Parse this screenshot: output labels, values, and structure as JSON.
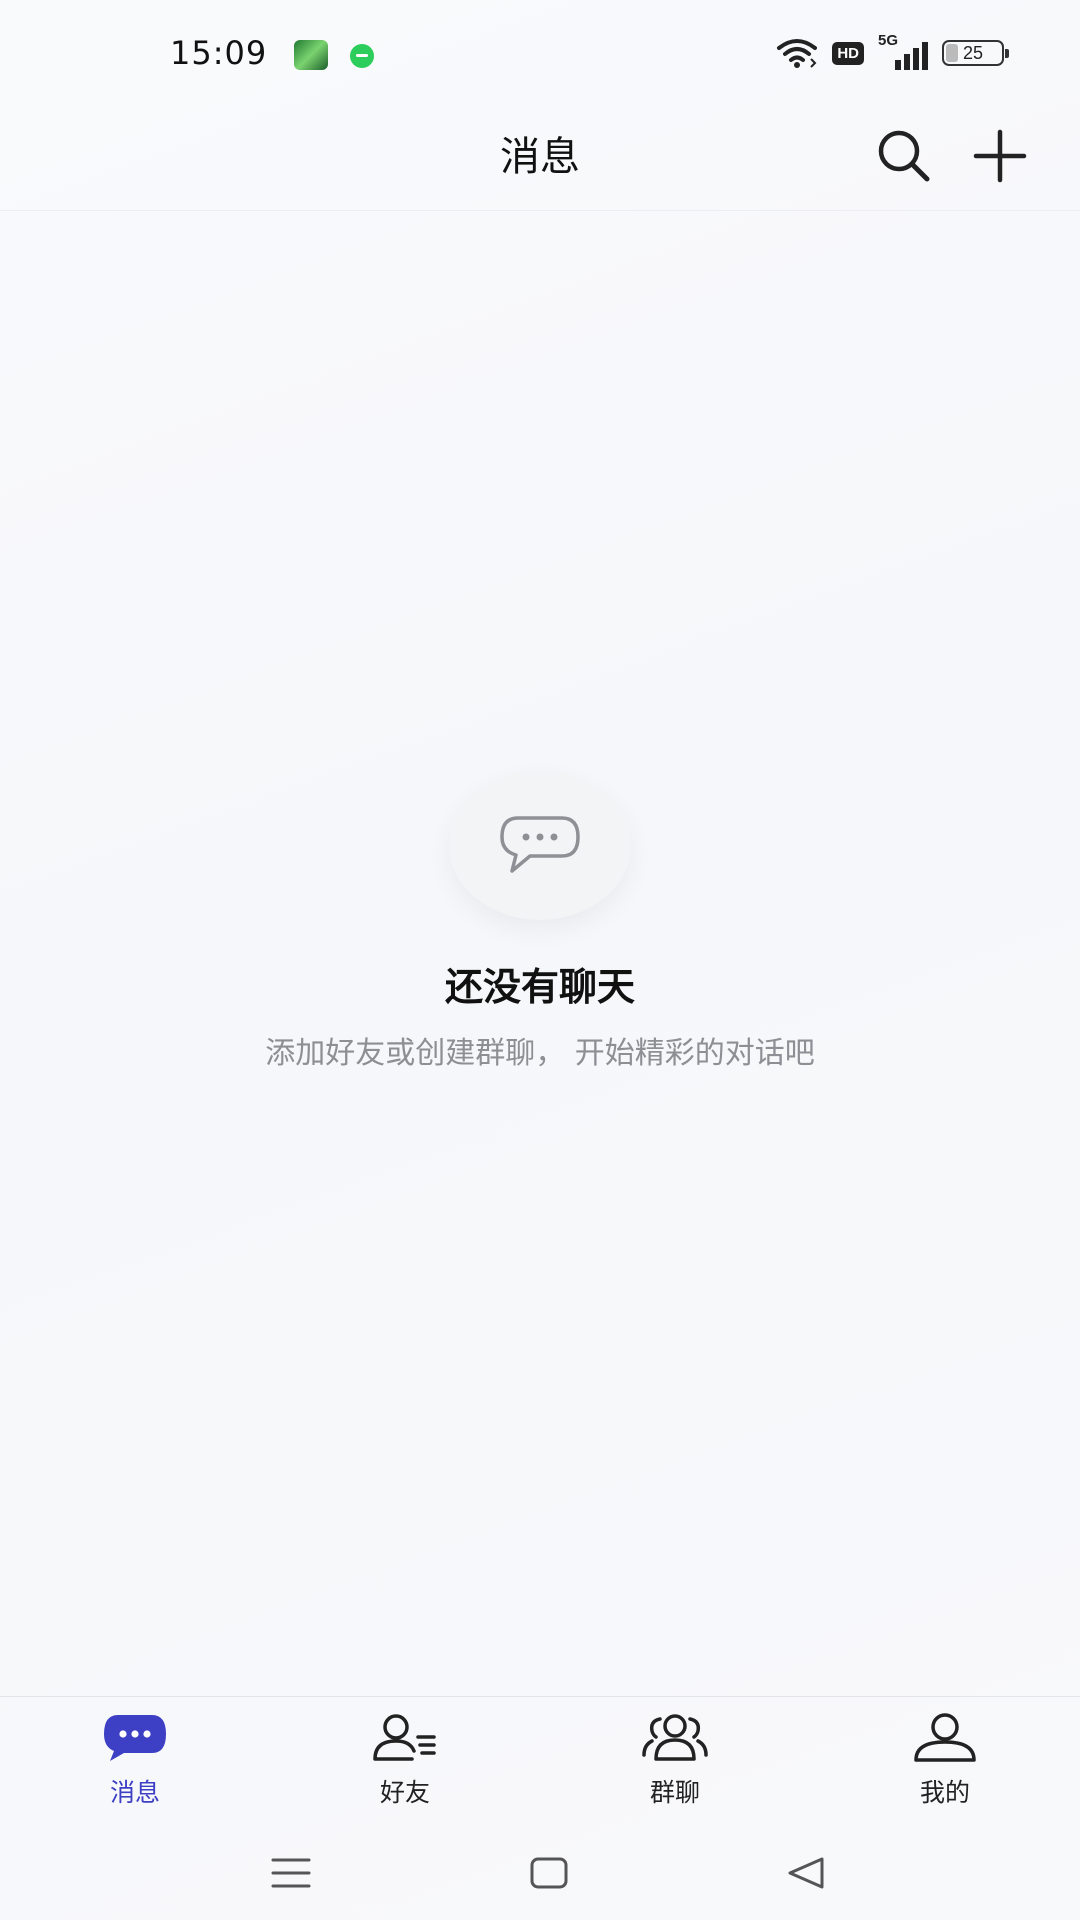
{
  "status_bar": {
    "time": "15:09",
    "network": "5G",
    "hd_label": "HD",
    "battery": "25"
  },
  "header": {
    "title": "消息"
  },
  "empty_state": {
    "title": "还没有聊天",
    "subtitle": "添加好友或创建群聊， 开始精彩的对话吧"
  },
  "bottom_nav": {
    "items": [
      {
        "label": "消息",
        "icon": "chat-bubble-icon",
        "active": true
      },
      {
        "label": "好友",
        "icon": "friends-icon",
        "active": false
      },
      {
        "label": "群聊",
        "icon": "group-icon",
        "active": false
      },
      {
        "label": "我的",
        "icon": "profile-icon",
        "active": false
      }
    ]
  },
  "colors": {
    "accent": "#3d3fc4",
    "background": "#f8f9fb",
    "text_primary": "#111111",
    "text_secondary": "#8d8f94"
  }
}
